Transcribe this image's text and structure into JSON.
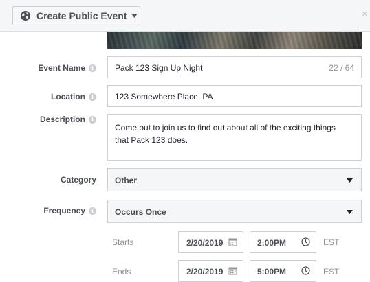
{
  "header": {
    "privacy_label": "Create Public Event",
    "privacy_icon": "globe-icon",
    "close_label": "×"
  },
  "form": {
    "event_name": {
      "label": "Event Name",
      "value": "Pack 123 Sign Up Night",
      "counter": "22 / 64"
    },
    "location": {
      "label": "Location",
      "value": "123 Somewhere Place, PA"
    },
    "description": {
      "label": "Description",
      "value": "Come out to join us to find out about all of the exciting things that Pack 123 does."
    },
    "category": {
      "label": "Category",
      "value": "Other"
    },
    "frequency": {
      "label": "Frequency",
      "value": "Occurs Once"
    },
    "starts": {
      "label": "Starts",
      "date": "2/20/2019",
      "time": "2:00PM",
      "timezone": "EST"
    },
    "ends": {
      "label": "Ends",
      "date": "2/20/2019",
      "time": "5:00PM",
      "timezone": "EST"
    }
  },
  "info_glyph": "i",
  "colors": {
    "label": "#4b4f56",
    "border": "#ccd0d5",
    "muted": "#90949c",
    "header_bg": "#f5f6f7"
  }
}
